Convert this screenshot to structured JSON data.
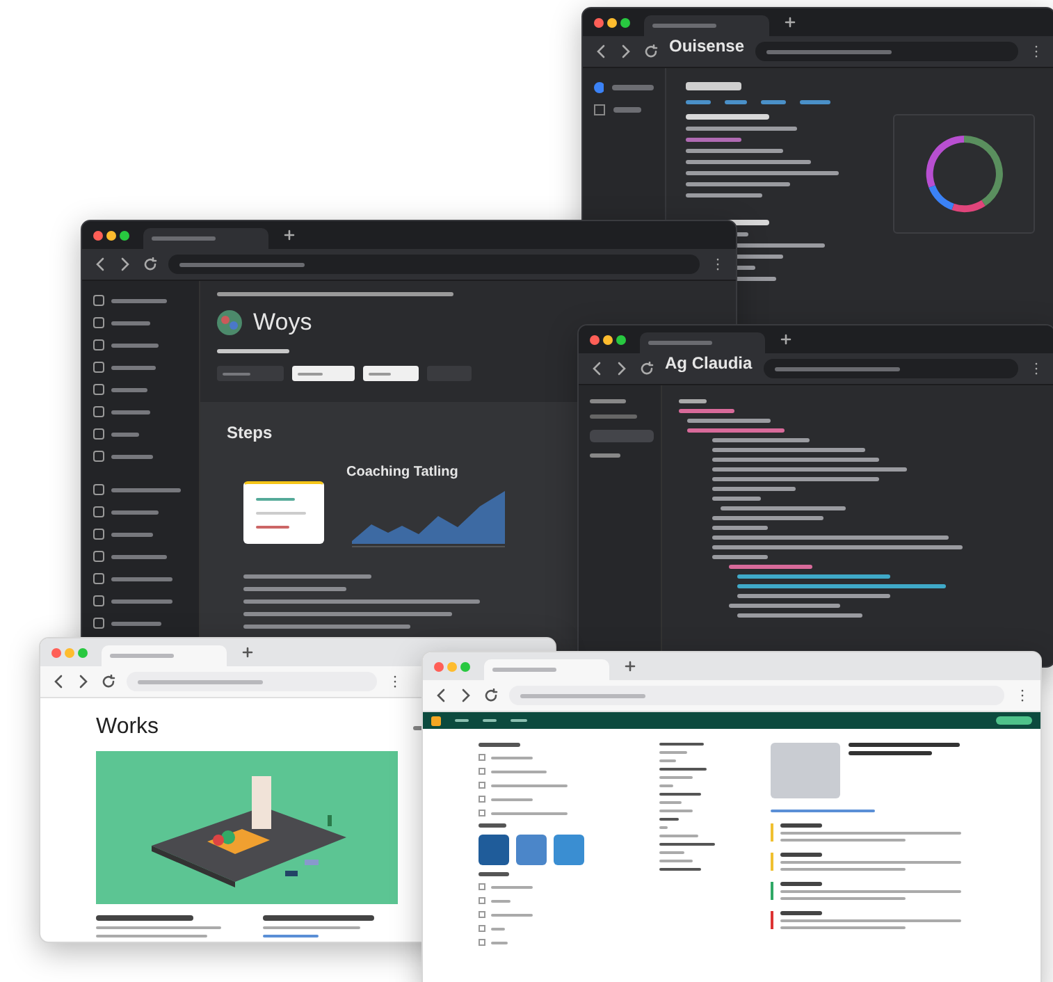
{
  "windows": [
    {
      "kind": "report",
      "title": "Ouisense"
    },
    {
      "kind": "article",
      "title": "Woys",
      "section": "Steps",
      "chart_title": "Coaching Tatling"
    },
    {
      "kind": "code",
      "title": "Ag Claudia"
    },
    {
      "kind": "gallery",
      "title": "Works"
    },
    {
      "kind": "shop",
      "filters": [
        {
          "checked": false
        },
        {
          "checked": false
        },
        {
          "checked": false
        },
        {
          "checked": false
        },
        {
          "checked": false
        }
      ],
      "options": [
        {
          "checked": false
        },
        {
          "checked": false
        },
        {
          "checked": false
        },
        {
          "checked": false
        },
        {
          "checked": false
        }
      ]
    }
  ]
}
